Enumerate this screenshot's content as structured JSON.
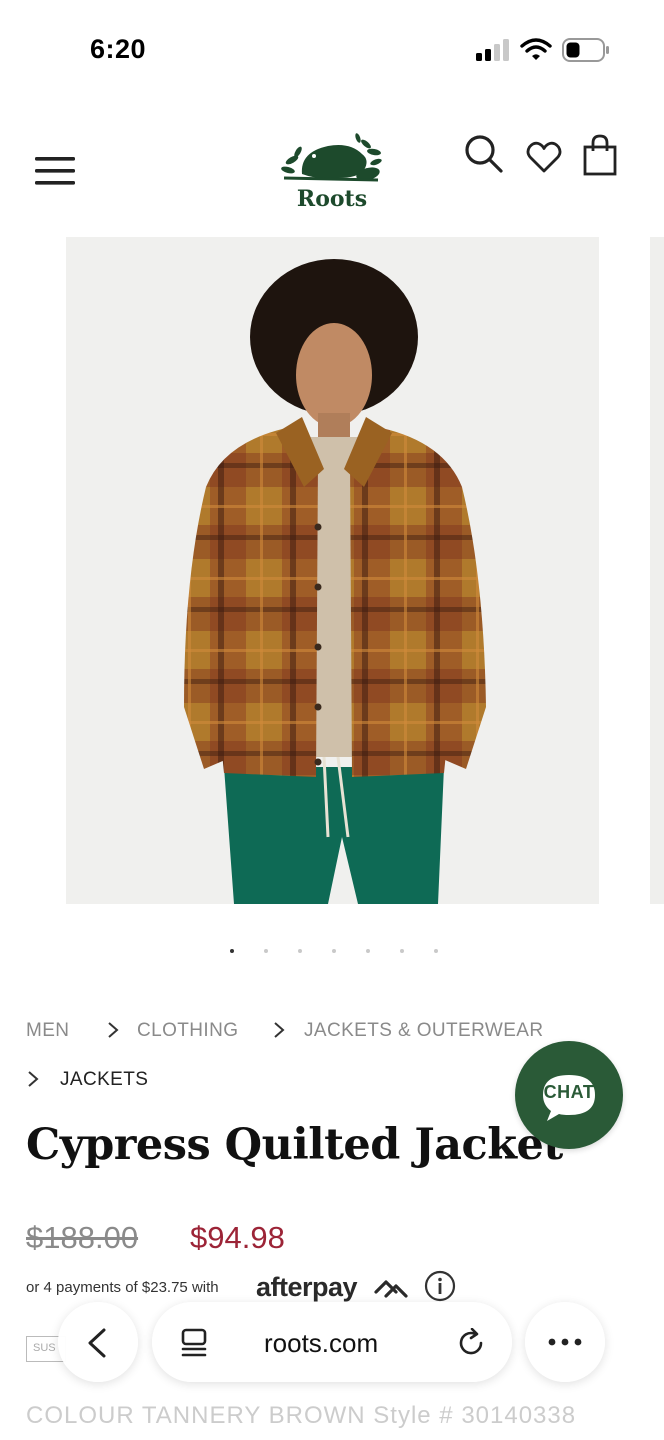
{
  "status_bar": {
    "time": "6:20"
  },
  "header": {
    "logo_text": "Roots"
  },
  "gallery": {
    "slide_count": 7,
    "active_index": 0
  },
  "breadcrumb": [
    {
      "label": "MEN"
    },
    {
      "label": "CLOTHING"
    },
    {
      "label": "JACKETS & OUTERWEAR"
    },
    {
      "label": "JACKETS"
    }
  ],
  "product": {
    "title": "Cypress Quilted Jacket",
    "price_original": "$188.00",
    "price_sale": "$94.98",
    "afterpay_text": "or 4 payments of $23.75 with",
    "afterpay_brand": "afterpay",
    "sustainability_badge": "SUS",
    "colour_line": "COLOUR   TANNERY BROWN   Style # 30140338"
  },
  "chat": {
    "label": "CHAT"
  },
  "browser": {
    "url": "roots.com"
  },
  "colors": {
    "brand_green": "#2a5a37",
    "sale_red": "#9c2437",
    "muted_grey": "#8a8a8a"
  },
  "icons": [
    "signal-icon",
    "wifi-icon",
    "battery-icon",
    "menu-icon",
    "search-icon",
    "heart-icon",
    "bag-icon",
    "chevron-right-icon",
    "info-icon",
    "chat-bubble-icon",
    "back-icon",
    "tabs-icon",
    "reload-icon",
    "more-icon"
  ]
}
